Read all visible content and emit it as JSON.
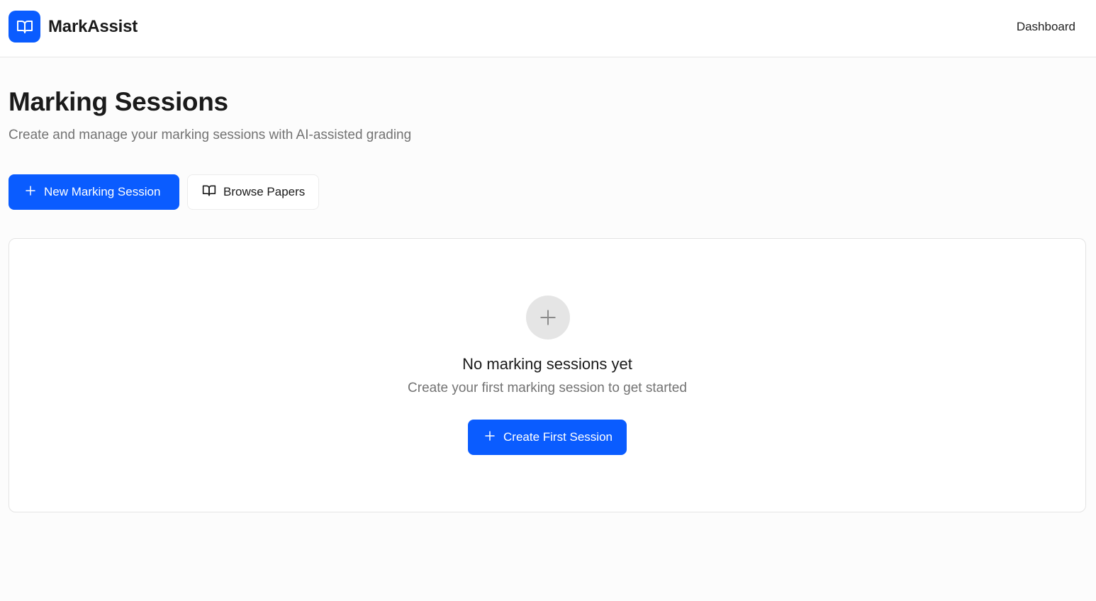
{
  "header": {
    "app_name": "MarkAssist",
    "logo_icon": "open-book-icon",
    "nav_dashboard": "Dashboard"
  },
  "page": {
    "title": "Marking Sessions",
    "subtitle": "Create and manage your marking sessions with AI-assisted grading"
  },
  "actions": {
    "new_session_label": "New Marking Session",
    "new_session_icon": "plus-icon",
    "browse_papers_label": "Browse Papers",
    "browse_papers_icon": "open-book-icon"
  },
  "empty_state": {
    "icon": "plus-icon",
    "title": "No marking sessions yet",
    "description": "Create your first marking session to get started",
    "cta_label": "Create First Session"
  },
  "colors": {
    "primary": "#0a5cff",
    "muted_text": "#737373",
    "background": "#fcfcfc"
  }
}
